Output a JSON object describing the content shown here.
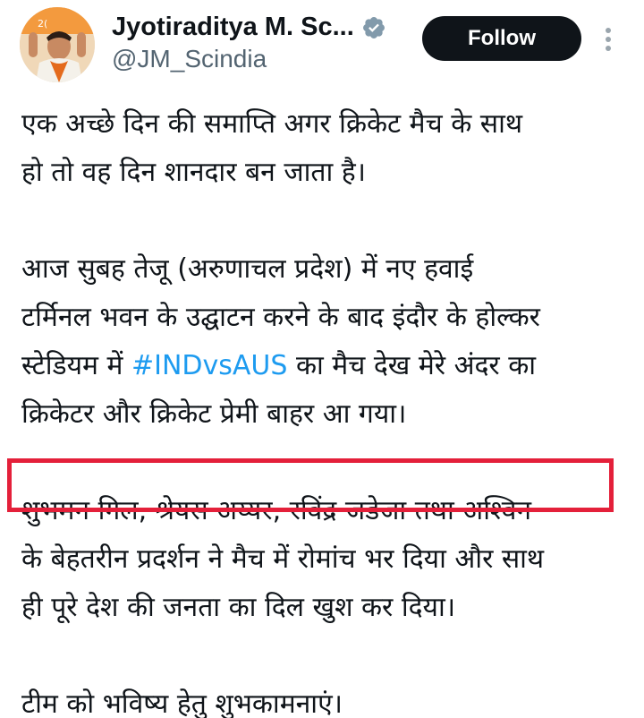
{
  "colors": {
    "follow_bg": "#0f1419",
    "hashtag": "#1d9bf0",
    "verified_badge": "#829aab",
    "highlight_border": "#e4203a",
    "handle_text": "#536471"
  },
  "header": {
    "display_name": "Jyotiraditya M. Sc...",
    "handle": "@JM_Scindia",
    "follow_label": "Follow",
    "verified_icon": "verified-badge-icon",
    "more_icon": "vertical-ellipsis-icon"
  },
  "tweet": {
    "p1_line1": "एक अच्छे दिन की समाप्ति अगर क्रिकेट मैच के साथ",
    "p1_line2": "हो तो वह दिन शानदार बन जाता है।",
    "p2_line1": "आज सुबह तेजू (अरुणाचल प्रदेश) में नए हवाई",
    "p2_line2": "टर्मिनल भवन के उद्घाटन करने के बाद इंदौर के होल्कर",
    "p2_line3_pre": "स्टेडियम में ",
    "hashtag": "#INDvsAUS",
    "p2_line3_post": " का मैच देख मेरे अंदर का",
    "p2_line4": "क्रिकेटर और क्रिकेट प्रेमी बाहर आ गया।",
    "p3_line1": "शुभमन गिल, श्रेयस अय्यर, रविंद्र जडेजा तथा अश्विन",
    "p3_line2": "के बेहतरीन प्रदर्शन ने मैच में रोमांच भर दिया और साथ",
    "p3_line3": "ही पूरे देश की जनता का दिल खुश कर दिया।",
    "p4_line1": "टीम को भविष्य हेतु शुभकामनाएं।"
  }
}
